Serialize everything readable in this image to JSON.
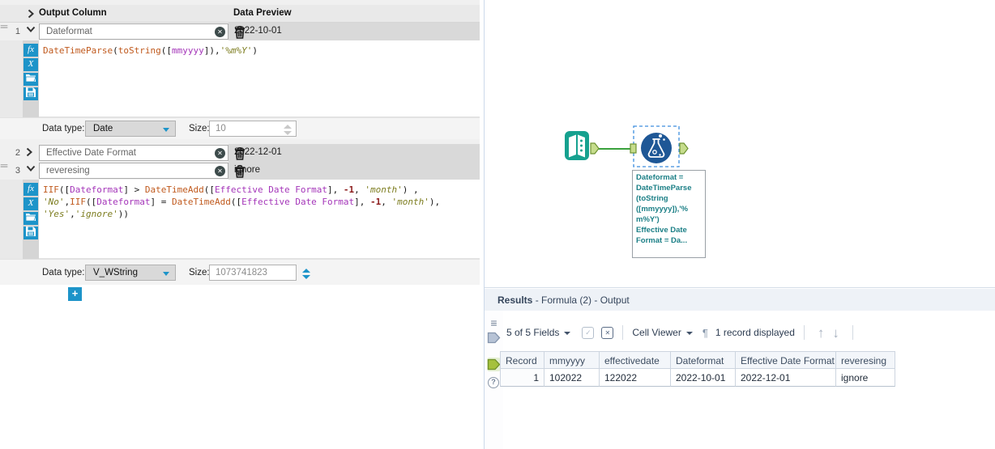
{
  "config": {
    "header": {
      "output_column": "Output Column",
      "data_preview": "Data Preview"
    },
    "labels": {
      "data_type": "Data type:",
      "size": "Size:"
    },
    "rows": [
      {
        "num": "1",
        "name": "Dateformat",
        "preview": "2022-10-01",
        "data_type": "Date",
        "size": "10",
        "formula_lines": [
          [
            {
              "t": "DateTimeParse",
              "c": "fn"
            },
            {
              "t": "(",
              "c": "p"
            },
            {
              "t": "toString",
              "c": "fn"
            },
            {
              "t": "([",
              "c": "p"
            },
            {
              "t": "mmyyyy",
              "c": "fld"
            },
            {
              "t": "]),",
              "c": "p"
            },
            {
              "t": "'%m%Y'",
              "c": "str"
            },
            {
              "t": ")",
              "c": "p"
            }
          ]
        ]
      },
      {
        "num": "2",
        "name": "Effective Date Format",
        "preview": "2022-12-01"
      },
      {
        "num": "3",
        "name": "reveresing",
        "preview": "ignore",
        "data_type": "V_WString",
        "size": "1073741823",
        "formula_lines": [
          [
            {
              "t": "IIF",
              "c": "fn"
            },
            {
              "t": "([",
              "c": "p"
            },
            {
              "t": "Dateformat",
              "c": "fld"
            },
            {
              "t": "] > ",
              "c": "p"
            },
            {
              "t": "DateTimeAdd",
              "c": "fn"
            },
            {
              "t": "([",
              "c": "p"
            },
            {
              "t": "Effective Date Format",
              "c": "fld"
            },
            {
              "t": "], ",
              "c": "p"
            },
            {
              "t": "-1",
              "c": "num"
            },
            {
              "t": ", ",
              "c": "p"
            },
            {
              "t": "'month'",
              "c": "str"
            },
            {
              "t": ") ,",
              "c": "p"
            }
          ],
          [
            {
              "t": "'No'",
              "c": "str"
            },
            {
              "t": ",",
              "c": "p"
            },
            {
              "t": "IIF",
              "c": "fn"
            },
            {
              "t": "([",
              "c": "p"
            },
            {
              "t": "Dateformat",
              "c": "fld"
            },
            {
              "t": "] = ",
              "c": "p"
            },
            {
              "t": "DateTimeAdd",
              "c": "fn"
            },
            {
              "t": "([",
              "c": "p"
            },
            {
              "t": "Effective Date Format",
              "c": "fld"
            },
            {
              "t": "], ",
              "c": "p"
            },
            {
              "t": "-1",
              "c": "num"
            },
            {
              "t": ", ",
              "c": "p"
            },
            {
              "t": "'month'",
              "c": "str"
            },
            {
              "t": "),",
              "c": "p"
            }
          ],
          [
            {
              "t": "'Yes'",
              "c": "str"
            },
            {
              "t": ",",
              "c": "p"
            },
            {
              "t": "'ignore'",
              "c": "str"
            },
            {
              "t": "))",
              "c": "p"
            }
          ]
        ]
      }
    ],
    "add_button": "+"
  },
  "canvas": {
    "annotation_lines": [
      "Dateformat =",
      "DateTimeParse",
      "(toString",
      "([mmyyyy]),'%",
      "m%Y')",
      "Effective Date",
      "Format = Da..."
    ]
  },
  "results": {
    "title_bold": "Results",
    "title_rest": " - Formula (2) - Output",
    "toolbar": {
      "fields_label": "5 of 5 Fields",
      "cell_viewer_label": "Cell Viewer",
      "record_count": "1 record displayed"
    },
    "table": {
      "headers": [
        "Record",
        "mmyyyy",
        "effectivedate",
        "Dateformat",
        "Effective Date Format",
        "reveresing"
      ],
      "rows": [
        [
          "1",
          "102022",
          "122022",
          "2022-10-01",
          "2022-12-01",
          "ignore"
        ]
      ]
    }
  },
  "icons": {
    "fx_glyph": "fx",
    "variables_glyph": "X",
    "clear_glyph": "✕",
    "drag_glyph": "≡≡",
    "list_glyph": "≡",
    "check_glyph": "✓",
    "xbox_glyph": "✕",
    "pilcrow_glyph": "¶",
    "up_arrow_glyph": "↑",
    "down_arrow_glyph": "↓",
    "help_glyph": "?"
  },
  "colors": {
    "accent_blue": "#1d94c9",
    "tool_circle_blue": "#1e5796",
    "input_tool_teal": "#16a18f",
    "anchor_green_fill": "#c6dc8c",
    "anchor_green_stroke": "#6d9332",
    "connection_green": "#3aa13c",
    "annotation_teal": "#1b7f86",
    "selection_dash_blue": "#3e8ede",
    "formula_function": "#c05a1e",
    "formula_field": "#a435b9",
    "formula_string": "#7d7d20",
    "formula_number": "#8b1a1a"
  }
}
